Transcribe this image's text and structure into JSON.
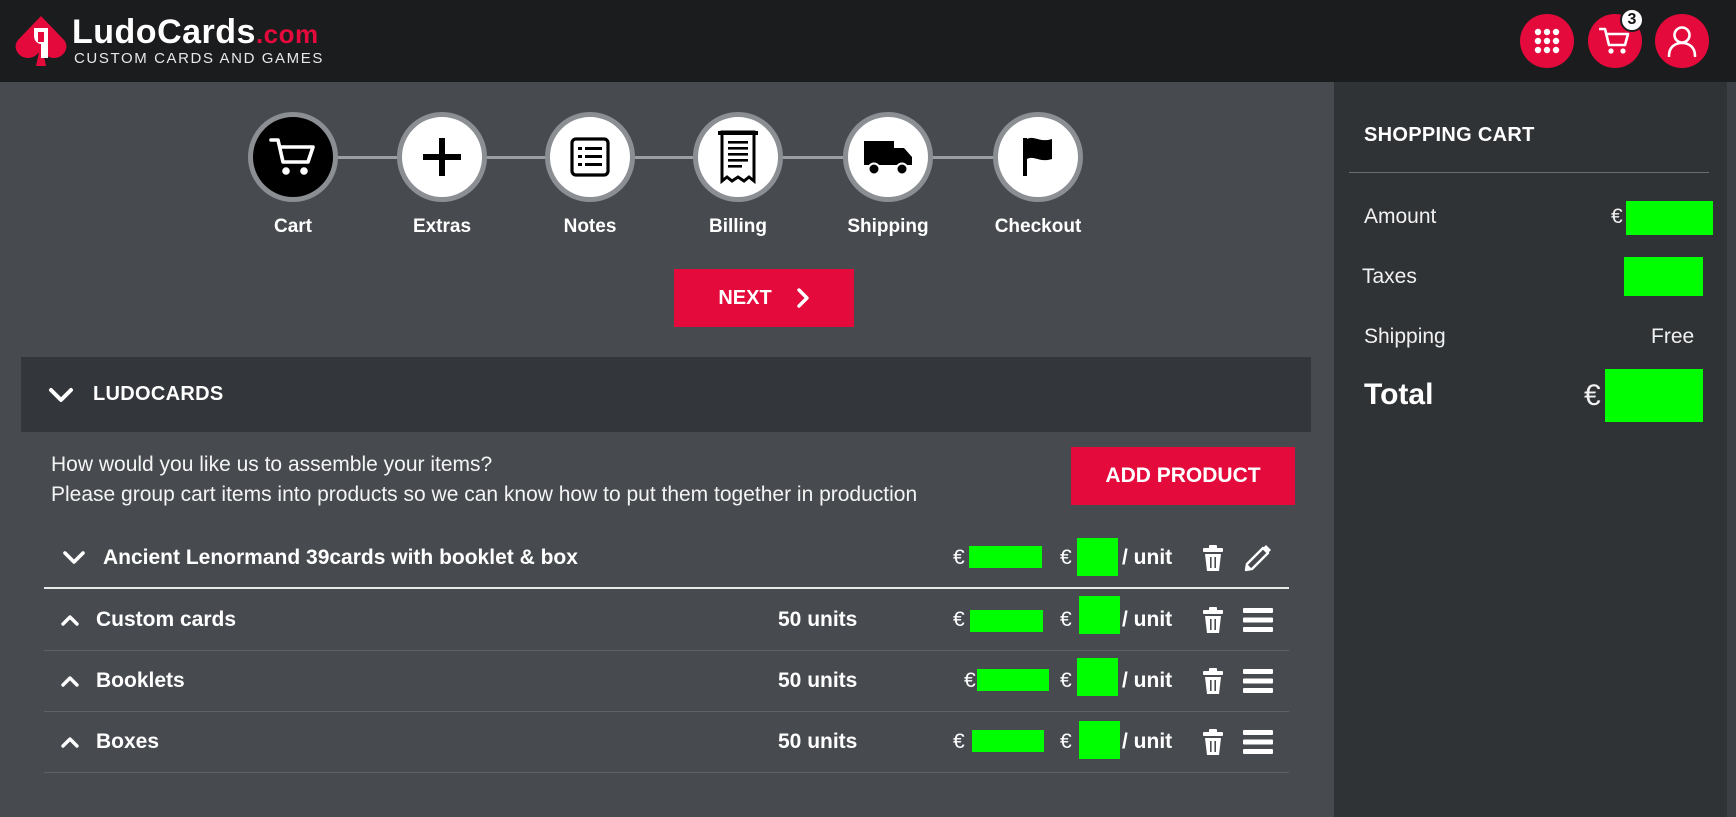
{
  "header": {
    "logo_name": "LudoCards",
    "logo_domain": ".com",
    "logo_tagline": "CUSTOM CARDS AND GAMES",
    "cart_count": "3",
    "icons": [
      "apps-grid-icon",
      "cart-icon",
      "user-icon"
    ],
    "accent_color": "#e40a3c"
  },
  "steps": [
    {
      "label": "Cart",
      "icon": "cart-icon",
      "active": true
    },
    {
      "label": "Extras",
      "icon": "plus-icon",
      "active": false
    },
    {
      "label": "Notes",
      "icon": "list-icon",
      "active": false
    },
    {
      "label": "Billing",
      "icon": "receipt-icon",
      "active": false
    },
    {
      "label": "Shipping",
      "icon": "truck-icon",
      "active": false
    },
    {
      "label": "Checkout",
      "icon": "flag-icon",
      "active": false
    }
  ],
  "next_label": "NEXT",
  "section": {
    "title": "LUDOCARDS",
    "assemble_line1": "How would you like us to assemble your items?",
    "assemble_line2": "Please group cart items into products so we can know how to put them together in production",
    "add_product_label": "ADD PRODUCT"
  },
  "product": {
    "name": "Ancient Lenormand 39cards with booklet & box",
    "currency": "€",
    "per_unit": "/ unit"
  },
  "items": [
    {
      "name": "Custom cards",
      "units": "50 units",
      "currency": "€",
      "per_unit": "/ unit"
    },
    {
      "name": "Booklets",
      "units": "50 units",
      "currency": "€",
      "per_unit": "/ unit"
    },
    {
      "name": "Boxes",
      "units": "50 units",
      "currency": "€",
      "per_unit": "/ unit"
    }
  ],
  "cart_panel": {
    "title": "SHOPPING CART",
    "amount_label": "Amount",
    "amount_currency": "€",
    "taxes_label": "Taxes",
    "shipping_label": "Shipping",
    "shipping_value": "Free",
    "total_label": "Total",
    "total_currency": "€"
  },
  "redaction_color": "#00ff00"
}
